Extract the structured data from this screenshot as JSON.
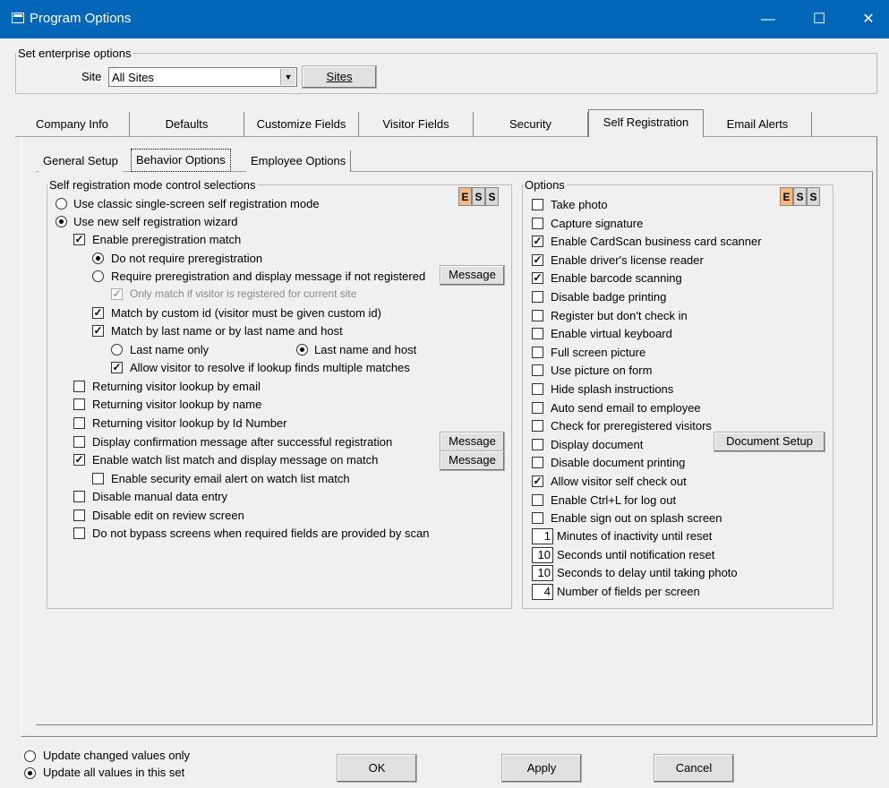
{
  "window": {
    "title": "Program Options",
    "minimize": "—",
    "maximize": "☐",
    "close": "✕"
  },
  "enterprise": {
    "legend": "Set enterprise options",
    "site_label": "Site",
    "site_value": "All Sites",
    "sites_button": "Sites"
  },
  "tabs": [
    "Company Info",
    "Defaults",
    "Customize Fields",
    "Visitor Fields",
    "Security",
    "Self Registration",
    "Email Alerts"
  ],
  "subtabs": [
    "General Setup",
    "Behavior Options",
    "Employee Options"
  ],
  "ess": [
    "E",
    "S",
    "S"
  ],
  "left": {
    "legend": "Self registration mode control selections",
    "classic_mode": "Use classic single-screen self registration mode",
    "wizard_mode": "Use new self registration wizard",
    "prereg_match": "Enable preregistration match",
    "no_prereg": "Do not require preregistration",
    "require_prereg": "Require preregistration and display message if not registered",
    "message_button": "Message",
    "only_match": "Only match if visitor is registered for current site",
    "match_custom_id": "Match by custom id (visitor must be given custom id)",
    "match_last_name": "Match by last name or by last name and host",
    "last_name_only": "Last name only",
    "last_name_host": "Last name and host",
    "allow_resolve": "Allow visitor to resolve if lookup finds multiple matches",
    "lookup_email": "Returning visitor lookup by email",
    "lookup_name": "Returning visitor lookup by name",
    "lookup_id": "Returning visitor lookup by Id Number",
    "display_confirm": "Display confirmation message after successful registration",
    "watch_list": "Enable watch list match and display message on match",
    "security_email": "Enable security email alert on watch list match",
    "disable_manual": "Disable manual data entry",
    "disable_edit": "Disable edit on review screen",
    "no_bypass": "Do not bypass screens when required fields are provided by scan"
  },
  "right": {
    "legend": "Options",
    "items": [
      {
        "label": "Take photo",
        "checked": false
      },
      {
        "label": "Capture signature",
        "checked": false
      },
      {
        "label": "Enable CardScan business card scanner",
        "checked": true
      },
      {
        "label": "Enable driver's license reader",
        "checked": true
      },
      {
        "label": "Enable barcode scanning",
        "checked": true
      },
      {
        "label": "Disable badge printing",
        "checked": false
      },
      {
        "label": "Register but don't check in",
        "checked": false
      },
      {
        "label": "Enable virtual keyboard",
        "checked": false
      },
      {
        "label": "Full screen picture",
        "checked": false
      },
      {
        "label": "Use picture on form",
        "checked": false
      },
      {
        "label": "Hide splash instructions",
        "checked": false
      },
      {
        "label": "Auto send email to employee",
        "checked": false
      },
      {
        "label": "Check for preregistered visitors",
        "checked": false
      },
      {
        "label": "Display document",
        "checked": false
      },
      {
        "label": "Disable document printing",
        "checked": false
      },
      {
        "label": "Allow visitor self check out",
        "checked": true
      },
      {
        "label": "Enable Ctrl+L for log out",
        "checked": false
      },
      {
        "label": "Enable sign out on splash screen",
        "checked": false
      }
    ],
    "document_setup_button": "Document Setup",
    "numeric": [
      {
        "value": "1",
        "label": "Minutes of inactivity until reset"
      },
      {
        "value": "10",
        "label": "Seconds until notification reset"
      },
      {
        "value": "10",
        "label": "Seconds to delay until taking photo"
      },
      {
        "value": "4",
        "label": "Number of fields per screen"
      }
    ]
  },
  "footer": {
    "update_changed": "Update changed values only",
    "update_all": "Update all values in this set",
    "ok": "OK",
    "apply": "Apply",
    "cancel": "Cancel"
  }
}
